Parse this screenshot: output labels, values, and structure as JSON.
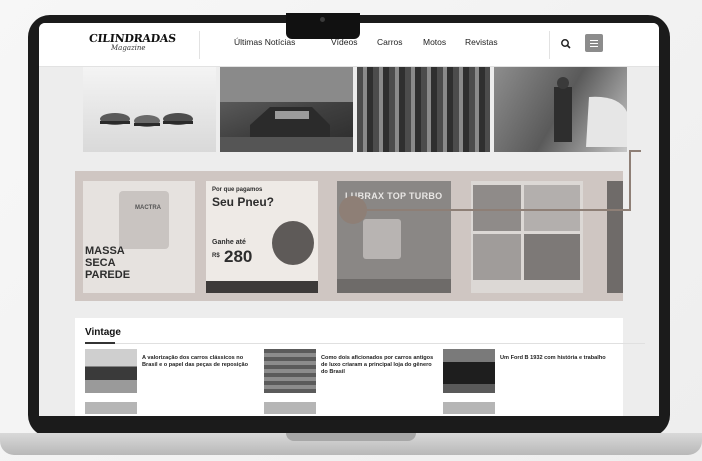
{
  "header": {
    "logo_main": "CILINDRADAS",
    "logo_sub": "Magazine",
    "nav": [
      "Últimas Notícias",
      "Vídeos",
      "Carros",
      "Motos",
      "Revistas"
    ],
    "search_icon": "search-icon",
    "menu_icon": "hamburger-menu-icon"
  },
  "ads": {
    "ad1": {
      "brand": "MACTRA",
      "lines": [
        "MASSA",
        "SECA",
        "PAREDE"
      ]
    },
    "ad2": {
      "lines": [
        "Por que pagamos",
        "Seu Pneu?"
      ],
      "cta": "Ganhe até",
      "currency": "R$",
      "amount": "280"
    },
    "ad3": {
      "title": "LUBRAX TOP TURBO"
    }
  },
  "vintage": {
    "title": "Vintage",
    "cards": [
      {
        "text": "A valorização dos carros clássicos no Brasil e o papel das peças de reposição"
      },
      {
        "text": "Como dois aficionados por carros antigos de luxo criaram a principal loja do gênero do Brasil"
      },
      {
        "text": "Um Ford B 1932 com história e trabalho"
      }
    ]
  },
  "colors": {
    "accent": "#8e7f76",
    "ad_band": "#cfc6c2"
  }
}
